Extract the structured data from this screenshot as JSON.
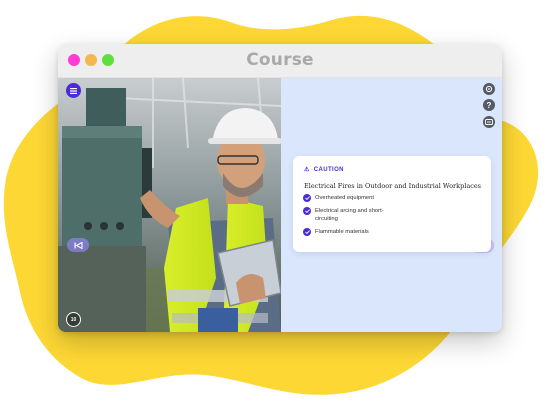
{
  "window": {
    "title": "Course"
  },
  "colors": {
    "blob": "#fdd835",
    "close": "#ff3bd3",
    "minimize": "#f2b84b",
    "maximize": "#5ee03c",
    "accent": "#4b2bd6",
    "panel": "#d9e6fb"
  },
  "icons": {
    "menu": "menu-icon",
    "rewind": "rewind-10-icon",
    "previous": "previous-icon",
    "next": "next-icon",
    "settings": "gear-icon",
    "help": "help-icon",
    "subtitles": "closed-captions-icon",
    "pause": "pause-icon"
  },
  "player": {
    "rewind_label": "10"
  },
  "card": {
    "label": "CAUTION",
    "title": "Electrical Fires in Outdoor and Industrial Workplaces",
    "items": [
      "Overheated equipment",
      "Electrical arcing and short-circuiting",
      "Flammable materials"
    ]
  }
}
